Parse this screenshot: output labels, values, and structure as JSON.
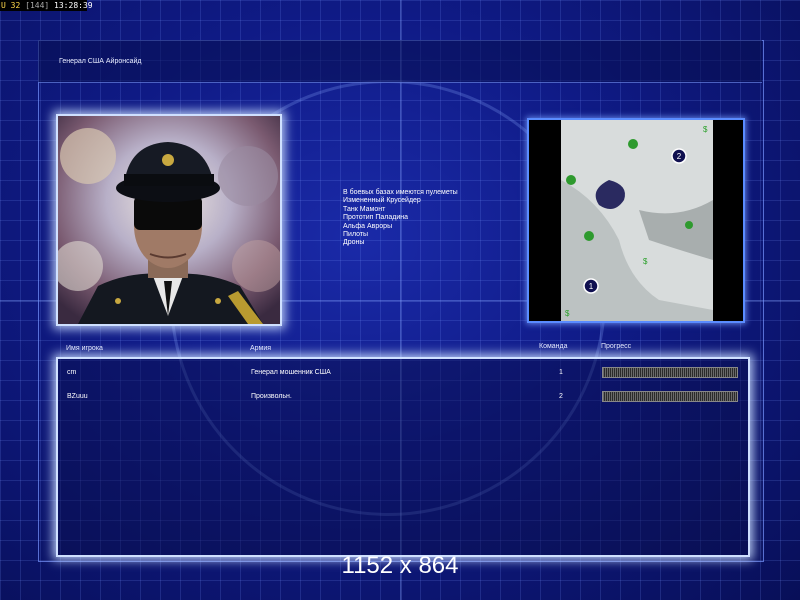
{
  "status_bar": {
    "u_label": "U",
    "u_value": "32",
    "memory": "[144]",
    "time": "13:28:39"
  },
  "general_title": "Генерал США Айронсайд",
  "intel_lines": [
    "В боевых базах имеются пулеметы",
    "Измененный Крусейдер",
    "Танк Мамонт",
    "Прототип Паладина",
    "Альфа Авроры",
    "Пилоты",
    "Дроны"
  ],
  "map": {
    "start_positions": [
      "1",
      "2"
    ],
    "supply_icon": "$"
  },
  "table": {
    "headers": {
      "player": "Имя игрока",
      "army": "Армия",
      "team": "Команда",
      "progress": "Прогресс"
    },
    "rows": [
      {
        "player": "cm",
        "army": "Генерал мошенник США",
        "team": "1",
        "progress": 1.0
      },
      {
        "player": "BZuuu",
        "army": "Произвольн.",
        "team": "2",
        "progress": 1.0
      }
    ]
  },
  "resolution_label": "1152 x 864",
  "colors": {
    "background": "#0f1a85",
    "glow_border": "#cfe0ff",
    "map_border": "#5a8cff",
    "status_accent": "#ffd84a"
  }
}
